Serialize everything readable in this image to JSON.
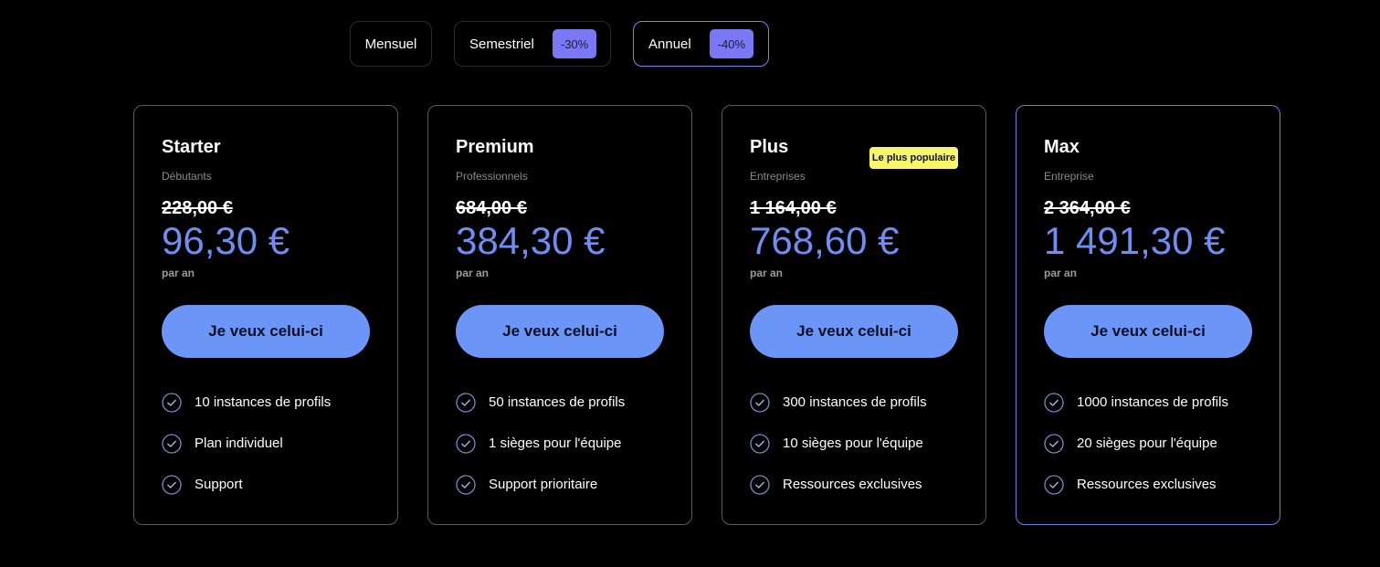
{
  "billing": {
    "options": [
      {
        "label": "Mensuel",
        "discount": ""
      },
      {
        "label": "Semestriel",
        "discount": "-30%"
      },
      {
        "label": "Annuel",
        "discount": "-40%"
      }
    ],
    "selected": "Annuel"
  },
  "colors": {
    "background": "#000000",
    "accent": "#6b95f7",
    "price": "#6e8ef5",
    "discount_badge": "#7b78f5",
    "popular_badge": "#f7f56b"
  },
  "plans": [
    {
      "name": "Starter",
      "subtitle": "Débutants",
      "old_price": "228,00 €",
      "price": "96,30 €",
      "period": "par an",
      "cta": "Je veux celui-ci",
      "features": [
        "10 instances de profils",
        "Plan individuel",
        "Support"
      ]
    },
    {
      "name": "Premium",
      "subtitle": "Professionnels",
      "old_price": "684,00 €",
      "price": "384,30 €",
      "period": "par an",
      "cta": "Je veux celui-ci",
      "features": [
        "50 instances de profils",
        "1 sièges pour l'équipe",
        "Support prioritaire"
      ]
    },
    {
      "name": "Plus",
      "subtitle": "Entreprises",
      "badge": "Le plus populaire",
      "old_price": "1 164,00 €",
      "price": "768,60 €",
      "period": "par an",
      "cta": "Je veux celui-ci",
      "features": [
        "300 instances de profils",
        "10 sièges pour l'équipe",
        "Ressources exclusives"
      ]
    },
    {
      "name": "Max",
      "subtitle": "Entreprise",
      "old_price": "2 364,00 €",
      "price": "1 491,30 €",
      "period": "par an",
      "cta": "Je veux celui-ci",
      "features": [
        "1000 instances de profils",
        "20 sièges pour l'équipe",
        "Ressources exclusives"
      ]
    }
  ]
}
